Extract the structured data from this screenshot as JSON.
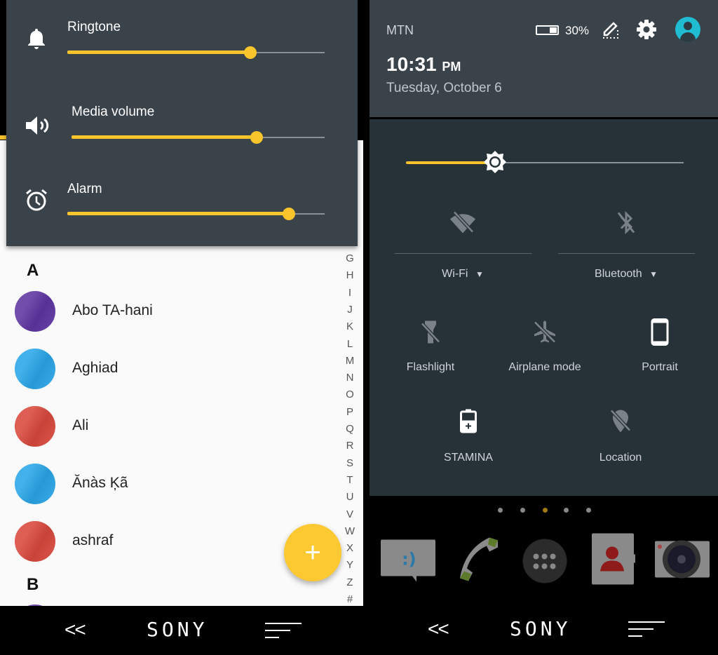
{
  "left_screen": {
    "volume_panel": [
      {
        "label": "Ringtone",
        "icon": "bell-icon",
        "level_percent": 71
      },
      {
        "label": "Media volume",
        "icon": "speaker-icon",
        "level_percent": 73
      },
      {
        "label": "Alarm",
        "icon": "alarm-clock-icon",
        "level_percent": 86
      }
    ],
    "contacts": {
      "sections": [
        "A",
        "B"
      ],
      "items": [
        {
          "name": "Abo TA-hani",
          "color": "#5e35a1"
        },
        {
          "name": "Aghiad",
          "color": "#29a6e8"
        },
        {
          "name": "Ali",
          "color": "#d9483d"
        },
        {
          "name": "Ănàs Ķã",
          "color": "#29a6e8"
        },
        {
          "name": "ashraf",
          "color": "#d9483d"
        }
      ],
      "index": [
        "G",
        "H",
        "I",
        "J",
        "K",
        "L",
        "M",
        "N",
        "O",
        "P",
        "Q",
        "R",
        "S",
        "T",
        "U",
        "V",
        "W",
        "X",
        "Y",
        "Z",
        "#"
      ],
      "fab_label": "+"
    },
    "nav": {
      "back": "<<",
      "brand": "SONY"
    }
  },
  "right_screen": {
    "carrier": "MTN",
    "battery": "30%",
    "time": "10:31",
    "ampm": "PM",
    "date": "Tuesday, October 6",
    "brightness_percent": 32,
    "tiles": [
      {
        "label": "Wi-Fi",
        "icon": "wifi-off-icon",
        "active": false,
        "dropdown": true
      },
      {
        "label": "Bluetooth",
        "icon": "bluetooth-off-icon",
        "active": false,
        "dropdown": true
      },
      {
        "label": "Flashlight",
        "icon": "flashlight-off-icon",
        "active": false
      },
      {
        "label": "Airplane mode",
        "icon": "airplane-off-icon",
        "active": false
      },
      {
        "label": "Portrait",
        "icon": "portrait-icon",
        "active": true
      },
      {
        "label": "STAMINA",
        "icon": "stamina-battery-icon",
        "active": true
      },
      {
        "label": "Location",
        "icon": "location-off-icon",
        "active": false
      }
    ],
    "page_dots": {
      "count": 5,
      "active": 3
    },
    "dock": [
      "messaging-icon",
      "phone-icon",
      "app-drawer-icon",
      "contacts-icon",
      "camera-icon"
    ],
    "nav": {
      "back": "<<",
      "brand": "SONY"
    }
  },
  "colors": {
    "accent": "#f9c42c",
    "panel": "#3a424a",
    "quick_settings": "#263238"
  }
}
